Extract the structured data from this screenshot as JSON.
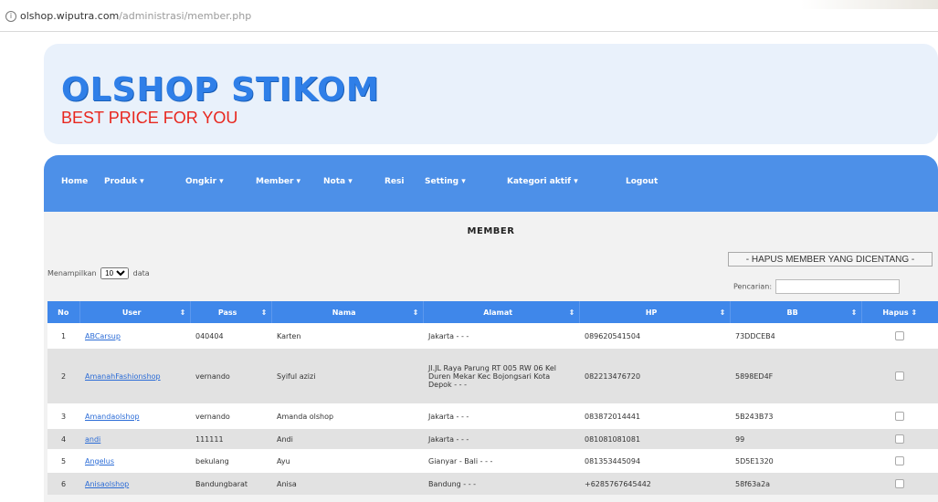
{
  "browser": {
    "url_host": "olshop.wiputra.com",
    "url_path": "/administrasi/member.php"
  },
  "header": {
    "logo_title": "OLSHOP STIKOM",
    "logo_subtitle": "BEST PRICE FOR YOU"
  },
  "nav": {
    "items": [
      "Home",
      "Produk ▾",
      "Ongkir ▾",
      "Member ▾",
      "Nota ▾",
      "Resi",
      "Setting ▾",
      "Kategori aktif ▾",
      "Logout"
    ]
  },
  "page": {
    "title": "MEMBER",
    "delete_button": "HAPUS MEMBER YANG DICENTANG",
    "show_prefix": "Menampilkan",
    "show_value": "10",
    "show_suffix": "data",
    "search_label": "Pencarian:"
  },
  "table": {
    "headers": [
      "No",
      "User",
      "Pass",
      "Nama",
      "Alamat",
      "HP",
      "BB",
      "Hapus"
    ],
    "rows": [
      {
        "no": "1",
        "user": "ABCarsup",
        "pass": "040404",
        "nama": "Karten",
        "alamat": "Jakarta - - -",
        "hp": "089620541504",
        "bb": "73DDCEB4"
      },
      {
        "no": "2",
        "user": "AmanahFashionshop",
        "pass": "vernando",
        "nama": "Syiful azizi",
        "alamat": "Jl.JL Raya Parung RT 005 RW 06 Kel Duren Mekar Kec Bojongsari Kota Depok - - -",
        "hp": "082213476720",
        "bb": "5898ED4F"
      },
      {
        "no": "3",
        "user": "Amandaolshop",
        "pass": "vernando",
        "nama": "Amanda olshop",
        "alamat": "Jakarta - - -",
        "hp": "083872014441",
        "bb": "5B243B73"
      },
      {
        "no": "4",
        "user": "andi",
        "pass": "111111",
        "nama": "Andi",
        "alamat": "Jakarta - - -",
        "hp": "081081081081",
        "bb": "99"
      },
      {
        "no": "5",
        "user": "Angelus",
        "pass": "bekulang",
        "nama": "Ayu",
        "alamat": "Gianyar - Bali - - -",
        "hp": "081353445094",
        "bb": "5D5E1320"
      },
      {
        "no": "6",
        "user": "Anisaolshop",
        "pass": "Bandungbarat",
        "nama": "Anisa",
        "alamat": "Bandung - - -",
        "hp": "+6285767645442",
        "bb": "58f63a2a"
      }
    ]
  },
  "colors": {
    "nav_bg": "#4d90e8",
    "header_bg": "#e9f1fb",
    "logo_blue": "#2f7fe8",
    "logo_red": "#e8271e"
  }
}
